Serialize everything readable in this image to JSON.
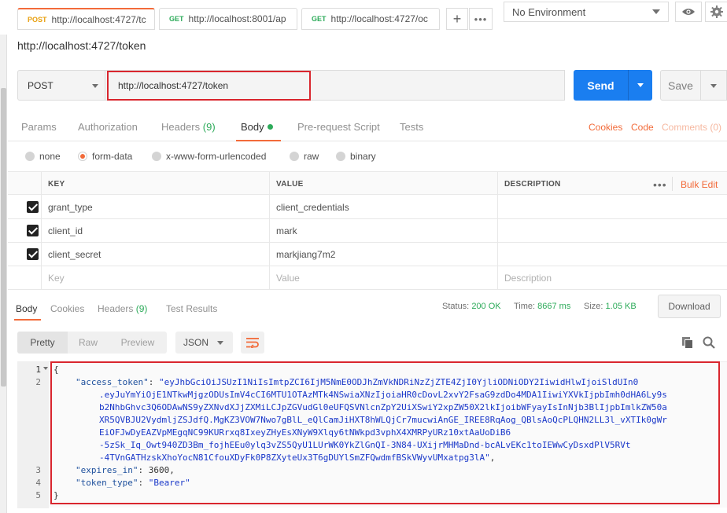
{
  "tabs": [
    {
      "method": "POST",
      "url": "http://localhost:4727/tc",
      "active": true
    },
    {
      "method": "GET",
      "url": "http://localhost:8001/ap",
      "active": false
    },
    {
      "method": "GET",
      "url": "http://localhost:4727/oc",
      "active": false
    }
  ],
  "tab_add_label": "+",
  "tab_more_label": "•••",
  "environment": {
    "selected": "No Environment"
  },
  "request": {
    "title": "http://localhost:4727/token",
    "method": "POST",
    "url": "http://localhost:4727/token",
    "send_label": "Send",
    "save_label": "Save"
  },
  "request_tabs": [
    {
      "label": "Params"
    },
    {
      "label": "Authorization"
    },
    {
      "label": "Headers",
      "count": "(9)"
    },
    {
      "label": "Body",
      "active": true
    },
    {
      "label": "Pre-request Script"
    },
    {
      "label": "Tests"
    }
  ],
  "request_links": {
    "cookies": "Cookies",
    "code": "Code",
    "comments": "Comments (0)"
  },
  "body_types": [
    {
      "label": "none",
      "checked": false
    },
    {
      "label": "form-data",
      "checked": true
    },
    {
      "label": "x-www-form-urlencoded",
      "checked": false
    },
    {
      "label": "raw",
      "checked": false
    },
    {
      "label": "binary",
      "checked": false
    }
  ],
  "kv_table": {
    "headers": {
      "key": "KEY",
      "value": "VALUE",
      "description": "DESCRIPTION"
    },
    "dots": "•••",
    "bulk_edit": "Bulk Edit",
    "rows": [
      {
        "key": "grant_type",
        "value": "client_credentials",
        "checked": true
      },
      {
        "key": "client_id",
        "value": "mark",
        "checked": true
      },
      {
        "key": "client_secret",
        "value": "markjiang7m2",
        "checked": true
      }
    ],
    "placeholders": {
      "key": "Key",
      "value": "Value",
      "description": "Description"
    }
  },
  "response_tabs": [
    {
      "label": "Body",
      "active": true
    },
    {
      "label": "Cookies"
    },
    {
      "label": "Headers",
      "count": "(9)"
    },
    {
      "label": "Test Results"
    }
  ],
  "response_meta": {
    "status_label": "Status:",
    "status_value": "200 OK",
    "time_label": "Time:",
    "time_value": "8667 ms",
    "size_label": "Size:",
    "size_value": "1.05 KB"
  },
  "download_label": "Download",
  "view_modes": [
    "Pretty",
    "Raw",
    "Preview"
  ],
  "format_select": "JSON",
  "code": {
    "line_numbers": [
      "1",
      "2",
      "3",
      "4",
      "5"
    ],
    "open_brace": "{",
    "close_brace": "}",
    "access_token_key": "\"access_token\"",
    "access_token_lines": [
      "\"eyJhbGciOiJSUzI1NiIsImtpZCI6IjM5NmE0ODJhZmVkNDRiNzZjZTE4ZjI0YjliODNiODY2IiwidHlwIjoiSldUIn0",
      ".eyJuYmYiOjE1NTkwMjgzODUsImV4cCI6MTU1OTAzMTk4NSwiaXNzIjoiaHR0cDovL2xvY2FsaG9zdDo4MDA1IiwiYXVkIjpbImh0dHA6Ly9s",
      "b2NhbGhvc3Q6ODAwNS9yZXNvdXJjZXMiLCJpZGVudGl0eUFQSVNlcnZpY2UiXSwiY2xpZW50X2lkIjoibWFyayIsInNjb3BlIjpbImlkZW50a",
      "XR5QVBJU2VydmljZSJdfQ.MgKZ3VOW7Nwo7gBlL_eQlCamJiHXT8hWLQjCr7mucwiAnGE_IREE8RqAog_QBlsAoQcPLQHN2LL3l_vXTIk0gWr",
      "EiOFJwDyEAZVpMEgqNC99KURrxq8IxeyZHyEsXNyW9Xlqy6tNWkpd3vphX4XMRPyURz10xtAaUoDiB6",
      "-5zSk_Iq_Owt940ZD3Bm_fojhEEu0ylq3vZS5QyU1LUrWK0YkZlGnQI-3N84-UXijrMHMaDnd-bcALvEKc1toIEWwCyDsxdPlV5RVt",
      "-4TVnGATHzskXhoYocN81CfouXDyFk0P8ZXyteUx3T6gDUYlSmZFQwdmfBSkVWyvUMxatpg3lA\""
    ],
    "access_token_trailer": ",",
    "expires_in_key": "\"expires_in\"",
    "expires_in_value": "3600",
    "expires_in_trailer": ",",
    "token_type_key": "\"token_type\"",
    "token_type_value": "\"Bearer\"",
    "colon": ": "
  },
  "colors": {
    "accent": "#f26b3a",
    "send": "#1a7ef0",
    "success": "#2dab5a",
    "highlight": "#d9262e"
  }
}
